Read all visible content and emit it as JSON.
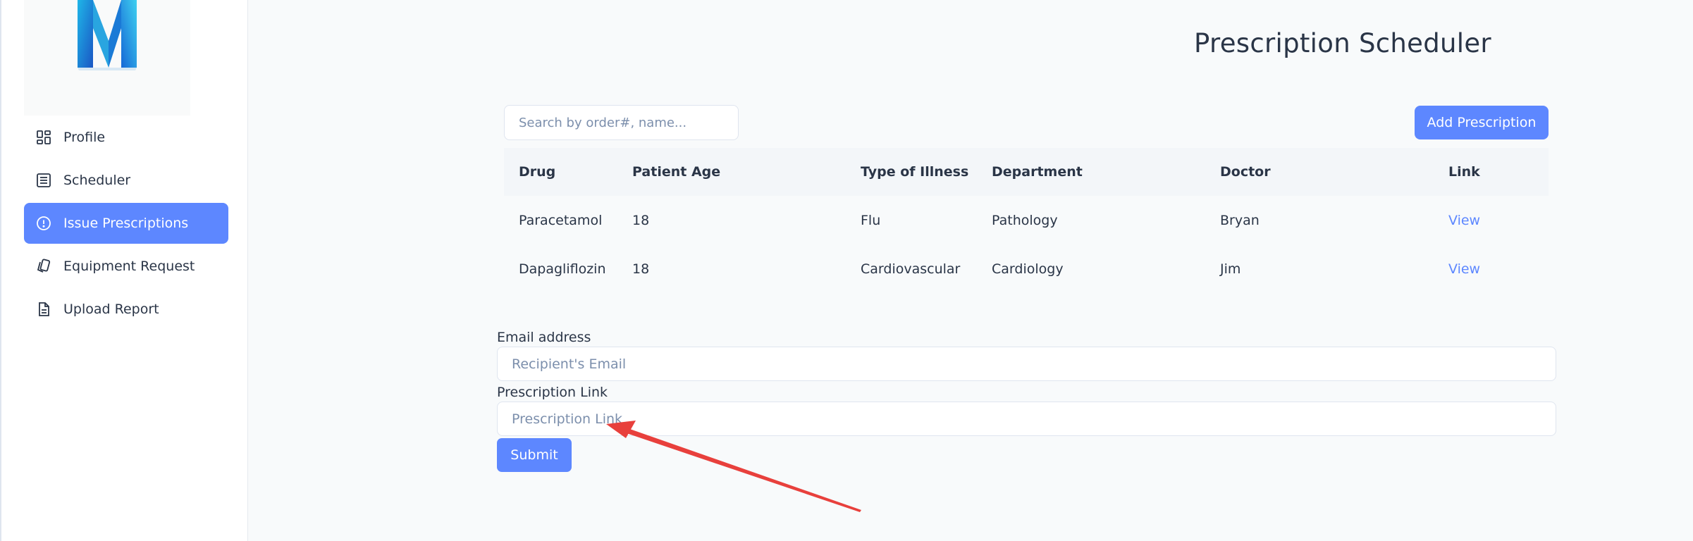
{
  "sidebar": {
    "items": [
      {
        "label": "Profile",
        "icon": "dashboard-icon"
      },
      {
        "label": "Scheduler",
        "icon": "list-icon"
      },
      {
        "label": "Issue Prescriptions",
        "icon": "alert-circle-icon",
        "active": true
      },
      {
        "label": "Equipment Request",
        "icon": "cards-icon"
      },
      {
        "label": "Upload Report",
        "icon": "file-icon"
      }
    ]
  },
  "main": {
    "title": "Prescription Scheduler",
    "search": {
      "placeholder": "Search by order#, name...",
      "value": ""
    },
    "add_button": "Add Prescription",
    "table": {
      "columns": [
        "Drug",
        "Patient Age",
        "Type of Illness",
        "Department",
        "Doctor",
        "Link"
      ],
      "rows": [
        [
          "Paracetamol",
          "18",
          "Flu",
          "Pathology",
          "Bryan",
          "View"
        ],
        [
          "Dapagliflozin",
          "18",
          "Cardiovascular",
          "Cardiology",
          "Jim",
          "View"
        ]
      ]
    },
    "form": {
      "email_label": "Email address",
      "email_placeholder": "Recipient's Email",
      "link_label": "Prescription Link",
      "link_placeholder": "Prescription Link",
      "submit": "Submit"
    }
  },
  "colors": {
    "accent": "#5d87ff",
    "annotation_arrow": "#e8403c"
  }
}
